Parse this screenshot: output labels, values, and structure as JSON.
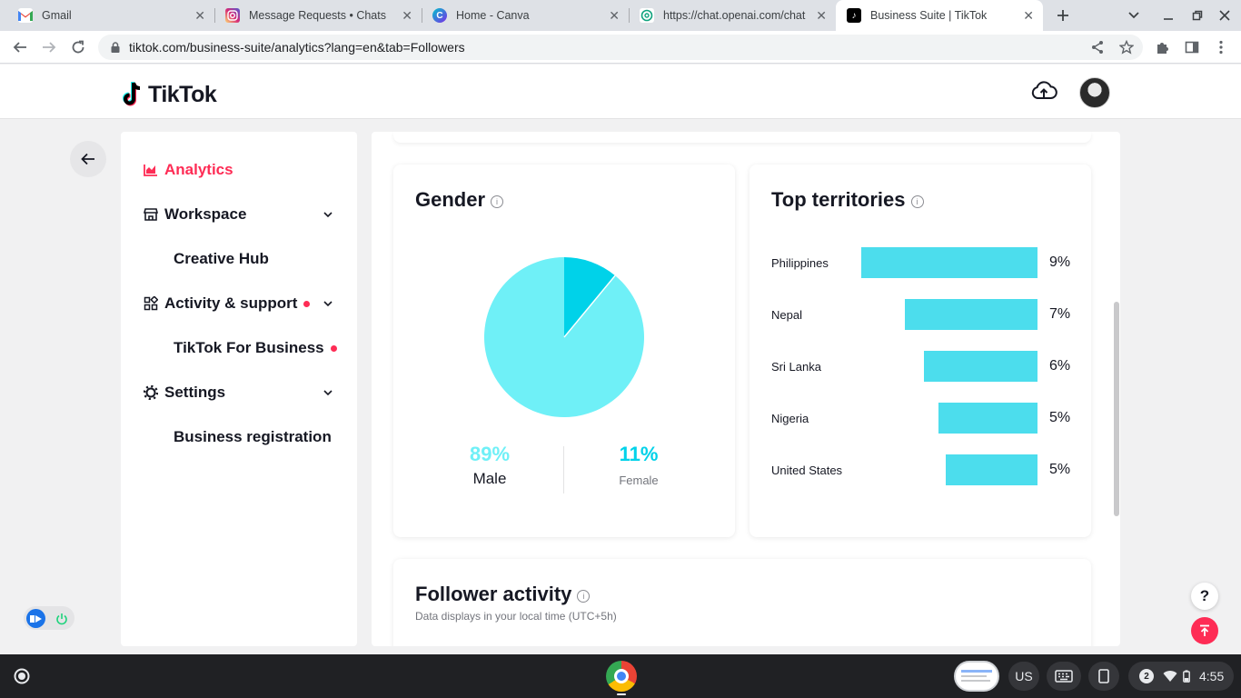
{
  "browser": {
    "tabs": [
      {
        "title": "Gmail",
        "favicon": "gmail-icon",
        "color": "#ea4335"
      },
      {
        "title": "Message Requests • Chats",
        "favicon": "instagram-icon",
        "color": "#d6249f"
      },
      {
        "title": "Home - Canva",
        "favicon": "canva-icon",
        "color": "#00c4cc"
      },
      {
        "title": "https://chat.openai.com/chat",
        "favicon": "openai-icon",
        "color": "#10a37f"
      },
      {
        "title": "Business Suite | TikTok",
        "favicon": "tiktok-icon",
        "color": "#000000"
      }
    ],
    "url": "tiktok.com/business-suite/analytics?lang=en&tab=Followers"
  },
  "header": {
    "logo_text": "TikTok"
  },
  "sidebar": {
    "items": [
      {
        "label": "Analytics",
        "icon": "chart-icon",
        "active": true
      },
      {
        "label": "Workspace",
        "icon": "store-icon"
      },
      {
        "label": "Creative Hub"
      },
      {
        "label": "Activity & support",
        "icon": "grid-icon"
      },
      {
        "label": "TikTok For Business"
      },
      {
        "label": "Settings",
        "icon": "gear-icon"
      },
      {
        "label": "Business registration"
      }
    ]
  },
  "gender": {
    "title": "Gender",
    "male_pct": "89%",
    "male_label": "Male",
    "female_pct": "11%",
    "female_label": "Female"
  },
  "territories": {
    "title": "Top territories",
    "rows": [
      {
        "name": "Philippines",
        "pct": "9%"
      },
      {
        "name": "Nepal",
        "pct": "7%"
      },
      {
        "name": "Sri Lanka",
        "pct": "6%"
      },
      {
        "name": "Nigeria",
        "pct": "5%"
      },
      {
        "name": "United States",
        "pct": "5%"
      }
    ]
  },
  "follower_activity": {
    "title": "Follower activity",
    "subtitle": "Data displays in your local time (UTC+5h)"
  },
  "help": {
    "label": "?"
  },
  "shelf": {
    "input_method": "US",
    "notifications": "2",
    "time": "4:55"
  },
  "colors": {
    "accent": "#fe2c55",
    "male": "#6ff0f7",
    "female": "#00d2e9",
    "bar": "#4cdded"
  }
}
